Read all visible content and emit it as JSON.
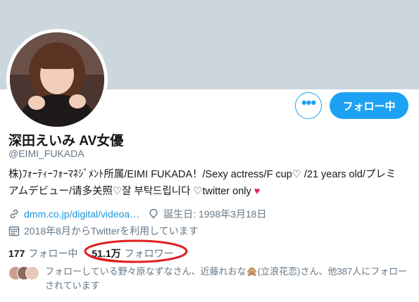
{
  "profile": {
    "name": "深田えいみ AV女優",
    "handle": "@EIMI_FUKADA",
    "bio": "株)ﾌｫｰﾃｨｰﾌｫｰﾏﾈｼﾞﾒﾝﾄ所属/EIMI FUKADA！/Sexy actress/F cup♡ /21 years old/プレミアムデビュー/请多关照♡잘 부탁드립니다 ♡twitter only",
    "bio_heart": "♥",
    "link": "dmm.co.jp/digital/videoa…",
    "birthday": "誕生日: 1998年3月18日",
    "joined": "2018年8月からTwitterを利用しています"
  },
  "buttons": {
    "more": "•••",
    "follow": "フォロー中"
  },
  "stats": {
    "following_count": "177",
    "following_label": "フォロー中",
    "followers_count": "51.1万",
    "followers_label": "フォロワー"
  },
  "followers_you_know": {
    "text": "フォローしている野々原なずなさん、近藤れおな🙊(立浪花恋)さん、他387人にフォローされています"
  },
  "colors": {
    "banner": "#ccd6dd",
    "accent": "#1da1f2",
    "annotation": "#e02020"
  },
  "icons": [
    "more-icon",
    "link-icon",
    "balloon-icon",
    "calendar-icon"
  ]
}
